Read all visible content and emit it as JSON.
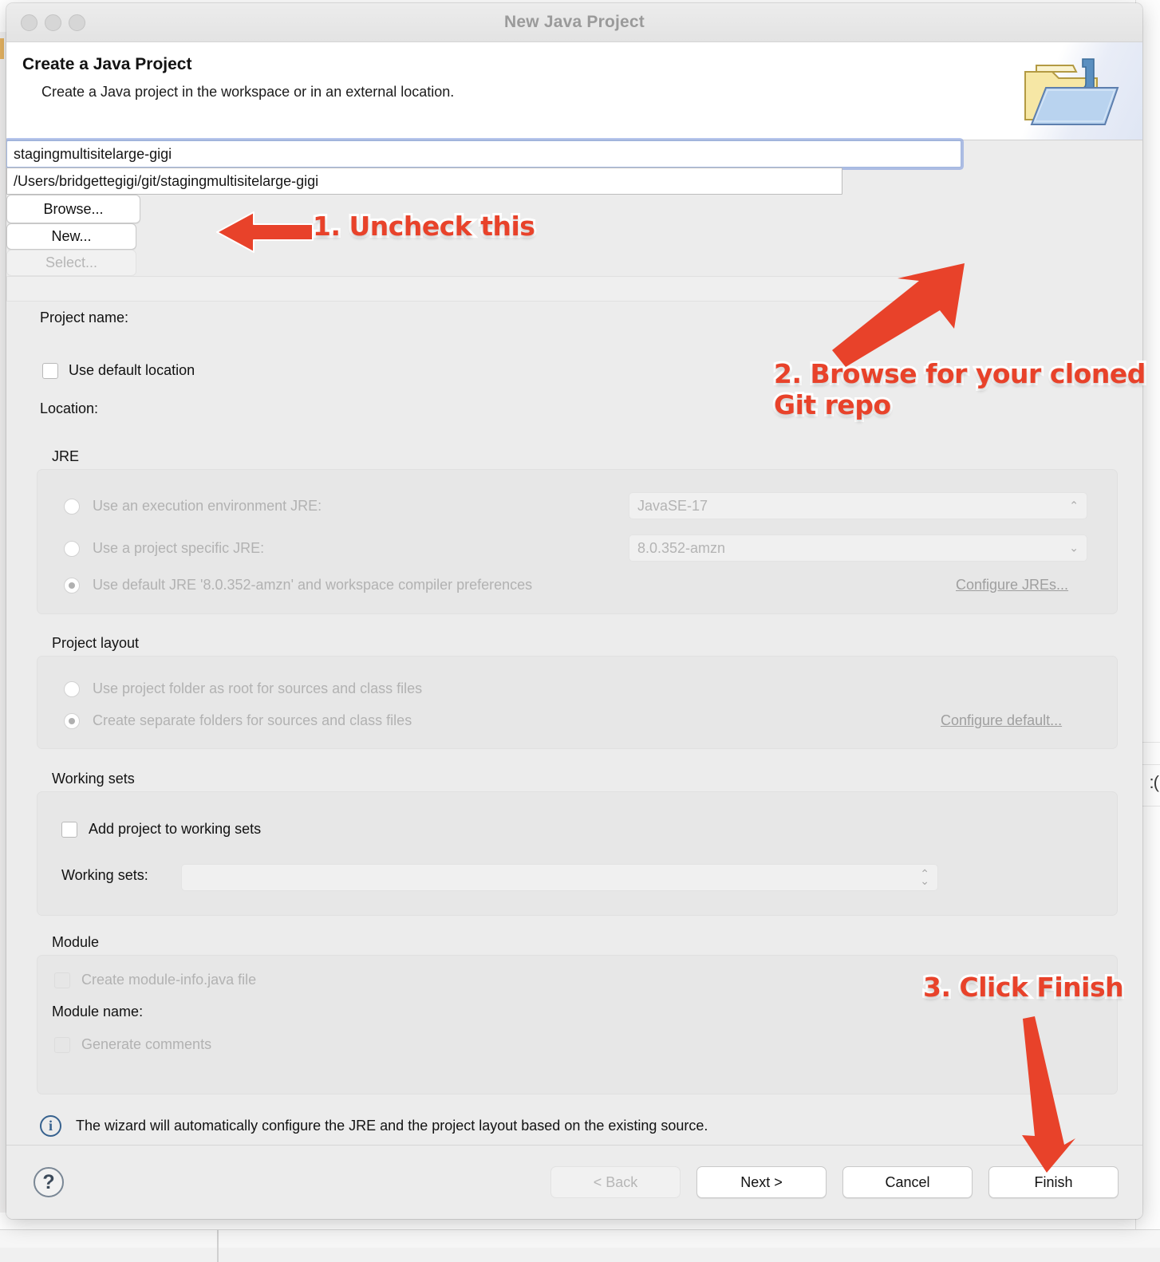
{
  "window": {
    "title": "New Java Project",
    "traffic_lights": [
      "close-button",
      "minimize-button",
      "zoom-button"
    ]
  },
  "header": {
    "title": "Create a Java Project",
    "description": "Create a Java project in the workspace or in an external location.",
    "icon": "java-project-folder-icon"
  },
  "form": {
    "project_name_label": "Project name:",
    "project_name_value": "stagingmultisitelarge-gigi",
    "use_default_location_label": "Use default location",
    "use_default_location_checked": false,
    "location_label": "Location:",
    "location_value": "/Users/bridgettegigi/git/stagingmultisitelarge-gigi",
    "browse_label": "Browse..."
  },
  "jre": {
    "group_title": "JRE",
    "options": [
      {
        "label": "Use an execution environment JRE:",
        "selected": false,
        "value": "JavaSE-17"
      },
      {
        "label": "Use a project specific JRE:",
        "selected": false,
        "value": "8.0.352-amzn"
      },
      {
        "label": "Use default JRE '8.0.352-amzn' and workspace compiler preferences",
        "selected": true
      }
    ],
    "configure_link": "Configure JREs..."
  },
  "project_layout": {
    "group_title": "Project layout",
    "options": [
      {
        "label": "Use project folder as root for sources and class files",
        "selected": false
      },
      {
        "label": "Create separate folders for sources and class files",
        "selected": true
      }
    ],
    "configure_link": "Configure default..."
  },
  "working_sets": {
    "group_title": "Working sets",
    "add_checkbox_label": "Add project to working sets",
    "add_checkbox_checked": false,
    "new_button": "New...",
    "working_sets_label": "Working sets:",
    "working_sets_value": "",
    "select_button": "Select..."
  },
  "module": {
    "group_title": "Module",
    "create_module_info_label": "Create module-info.java file",
    "create_module_info_checked": false,
    "module_name_label": "Module name:",
    "module_name_value": "",
    "generate_comments_label": "Generate comments",
    "generate_comments_checked": false
  },
  "info": {
    "icon": "info-icon",
    "text": "The wizard will automatically configure the JRE and the project layout based on the existing source."
  },
  "footer": {
    "help_label": "?",
    "buttons": [
      {
        "label": "< Back",
        "disabled": true
      },
      {
        "label": "Next >",
        "disabled": false
      },
      {
        "label": "Cancel",
        "disabled": false
      },
      {
        "label": "Finish",
        "disabled": false
      }
    ]
  },
  "annotations": [
    {
      "id": "step1",
      "text": "1. Uncheck this"
    },
    {
      "id": "step2",
      "text": "2. Browse for your cloned\nGit repo"
    },
    {
      "id": "step3",
      "text": "3. Click Finish"
    }
  ],
  "colors": {
    "annotation_red": "#e8422a",
    "focus_blue": "#7896dc",
    "info_blue": "#36618e"
  }
}
